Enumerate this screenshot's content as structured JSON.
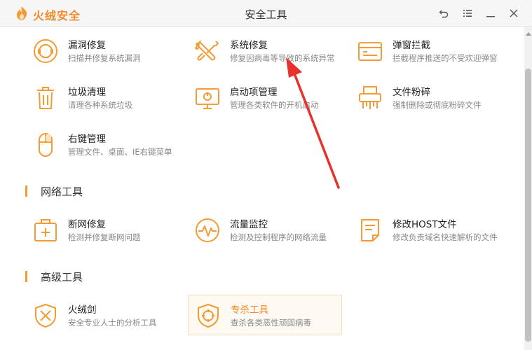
{
  "app": {
    "name": "火绒安全",
    "window_title": "安全工具"
  },
  "colors": {
    "accent": "#f39b34",
    "arrow": "#e8302c",
    "active_bg": "#fffaf1"
  },
  "sections": {
    "network": "网络工具",
    "advanced": "高级工具"
  },
  "tools": {
    "system": [
      {
        "title": "漏洞修复",
        "desc": "扫描并修复系统漏洞",
        "icon": "vulnerability-fix-icon"
      },
      {
        "title": "系统修复",
        "desc": "修复因病毒等导致的系统异常",
        "icon": "wrench-screwdriver-icon"
      },
      {
        "title": "弹窗拦截",
        "desc": "拦截程序推送的不受欢迎弹窗",
        "icon": "popup-window-icon"
      },
      {
        "title": "垃圾清理",
        "desc": "清理各种系统垃圾",
        "icon": "trash-icon"
      },
      {
        "title": "启动项管理",
        "desc": "管理各类软件的开机启动",
        "icon": "monitor-startup-icon"
      },
      {
        "title": "文件粉碎",
        "desc": "强制删除或彻底粉碎文件",
        "icon": "shredder-icon"
      },
      {
        "title": "右键管理",
        "desc": "管理文件、桌面、IE右键菜单",
        "icon": "mouse-icon"
      }
    ],
    "network": [
      {
        "title": "断网修复",
        "desc": "检测并修复断网问题",
        "icon": "network-repair-icon"
      },
      {
        "title": "流量监控",
        "desc": "检测及控制程序的网络流量",
        "icon": "traffic-monitor-icon"
      },
      {
        "title": "修改HOST文件",
        "desc": "修改负责域名快速解析的文件",
        "icon": "host-file-icon"
      }
    ],
    "advanced": [
      {
        "title": "火绒剑",
        "desc": "安全专业人士的分析工具",
        "icon": "sword-shield-icon"
      },
      {
        "title": "专杀工具",
        "desc": "查杀各类恶性顽固病毒",
        "icon": "virus-kill-shield-icon"
      }
    ]
  }
}
